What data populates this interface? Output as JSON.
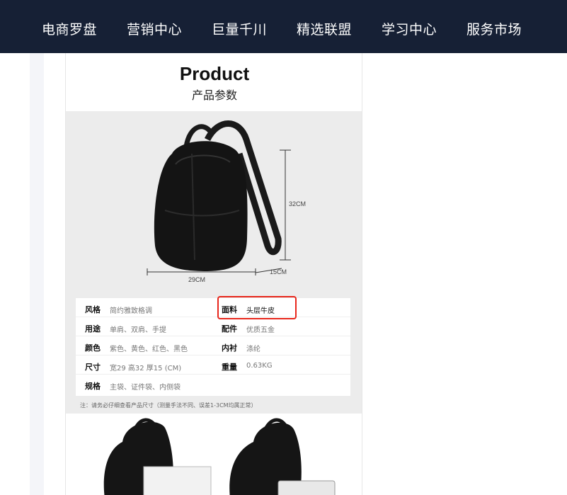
{
  "nav": {
    "items": [
      {
        "label": "电商罗盘"
      },
      {
        "label": "营销中心"
      },
      {
        "label": "巨量千川"
      },
      {
        "label": "精选联盟"
      },
      {
        "label": "学习中心"
      },
      {
        "label": "服务市场"
      }
    ]
  },
  "product": {
    "title": "Product",
    "subtitle": "产品参数",
    "dimensions": {
      "height": "32CM",
      "width": "29CM",
      "depth": "15CM"
    },
    "specs": [
      {
        "label": "风格",
        "value": "简约雅致格调",
        "label2": "面料",
        "value2": "头层牛皮"
      },
      {
        "label": "用途",
        "value": "单肩、双肩、手提",
        "label2": "配件",
        "value2": "优质五金"
      },
      {
        "label": "颜色",
        "value": "紫色、黄色、红色、黑色",
        "label2": "内衬",
        "value2": "涤纶"
      },
      {
        "label": "尺寸",
        "value": "宽29  高32  厚15 (CM)",
        "label2": "重量",
        "value2": "0.63KG"
      },
      {
        "label": "规格",
        "value": "主袋、证件袋、内侧袋"
      }
    ],
    "note": "注：请务必仔细查看产品尺寸（测量手法不同、误差1-3CM均属正常）"
  },
  "colors": {
    "nav_bg": "#162035",
    "highlight": "#e8271c"
  }
}
